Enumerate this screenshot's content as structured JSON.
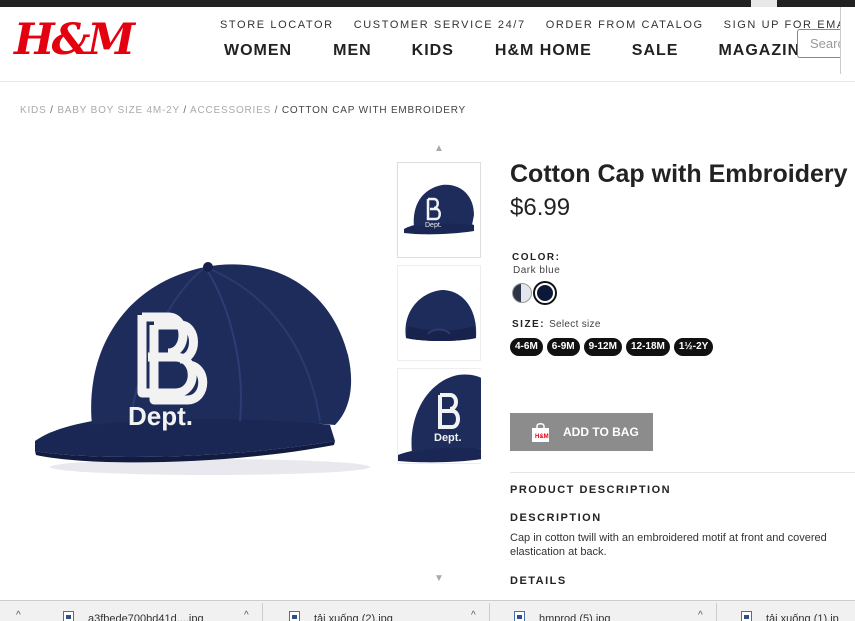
{
  "nav": {
    "logo": "H&M",
    "utility_links": [
      "STORE LOCATOR",
      "CUSTOMER SERVICE 24/7",
      "ORDER FROM CATALOG",
      "SIGN UP FOR EMAILS"
    ],
    "main_links": [
      "WOMEN",
      "MEN",
      "KIDS",
      "H&M HOME",
      "SALE",
      "MAGAZINE"
    ],
    "search_placeholder": "Search"
  },
  "breadcrumb": {
    "items": [
      "KIDS",
      "BABY BOY SIZE 4M-2Y",
      "ACCESSORIES"
    ],
    "separator": "/",
    "current": "COTTON CAP WITH EMBROIDERY"
  },
  "product": {
    "title": "Cotton Cap with Embroidery",
    "price": "$6.99",
    "color_label": "COLOR:",
    "color_value": "Dark blue",
    "size_label": "SIZE:",
    "size_hint": "Select size",
    "sizes": [
      "4-6M",
      "6-9M",
      "9-12M",
      "12-18M",
      "1½-2Y"
    ],
    "add_to_bag": "ADD TO BAG",
    "cap_text": "Dept."
  },
  "description": {
    "section_heading": "PRODUCT DESCRIPTION",
    "heading": "DESCRIPTION",
    "text_line1": "Cap in cotton twill with an embroidered motif at front and covered",
    "text_line2": "elastication at back.",
    "details_heading": "DETAILS"
  },
  "colors": {
    "brand_red": "#e50010",
    "cap_navy": "#1e2c5c",
    "button_gray": "#8c8c8c"
  },
  "downloads": {
    "files": [
      "a3fbede700bd41d....jpg",
      "tải xuống (2).jpg",
      "hmprod (5).jpg",
      "tải xuống (1).jp"
    ]
  }
}
